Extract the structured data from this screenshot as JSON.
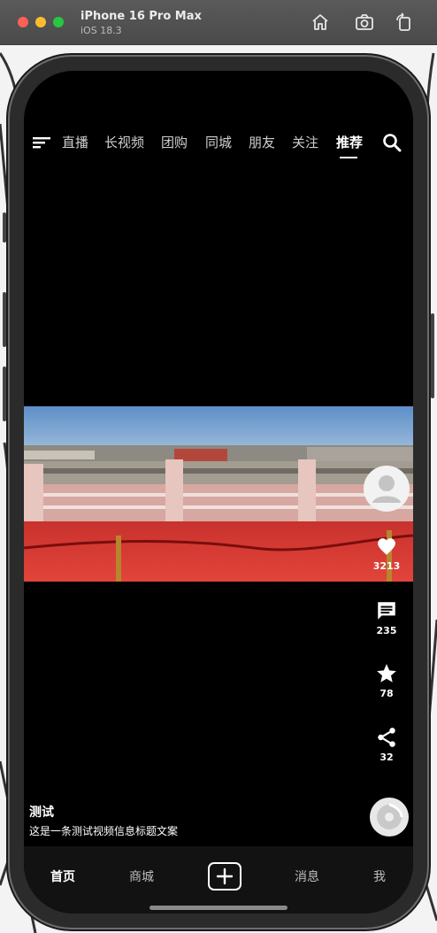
{
  "titlebar": {
    "device_name": "iPhone 16 Pro Max",
    "os_version": "iOS 18.3"
  },
  "topnav": {
    "tabs": [
      {
        "label": "直播",
        "active": false
      },
      {
        "label": "长视频",
        "active": false
      },
      {
        "label": "团购",
        "active": false
      },
      {
        "label": "同城",
        "active": false
      },
      {
        "label": "朋友",
        "active": false
      },
      {
        "label": "关注",
        "active": false
      },
      {
        "label": "推荐",
        "active": true
      }
    ]
  },
  "rail": {
    "likes": "3213",
    "comments": "235",
    "favorites": "78",
    "shares": "32"
  },
  "caption": {
    "author": "测试",
    "description": "这是一条测试视频信息标题文案"
  },
  "bottomnav": {
    "items": [
      "首页",
      "商城",
      "消息",
      "我"
    ]
  },
  "icons": {
    "menu": "menu-icon",
    "search": "search-icon",
    "like": "heart-icon",
    "comment": "comment-icon",
    "favorite": "star-icon",
    "share": "share-icon",
    "create": "plus-icon"
  }
}
